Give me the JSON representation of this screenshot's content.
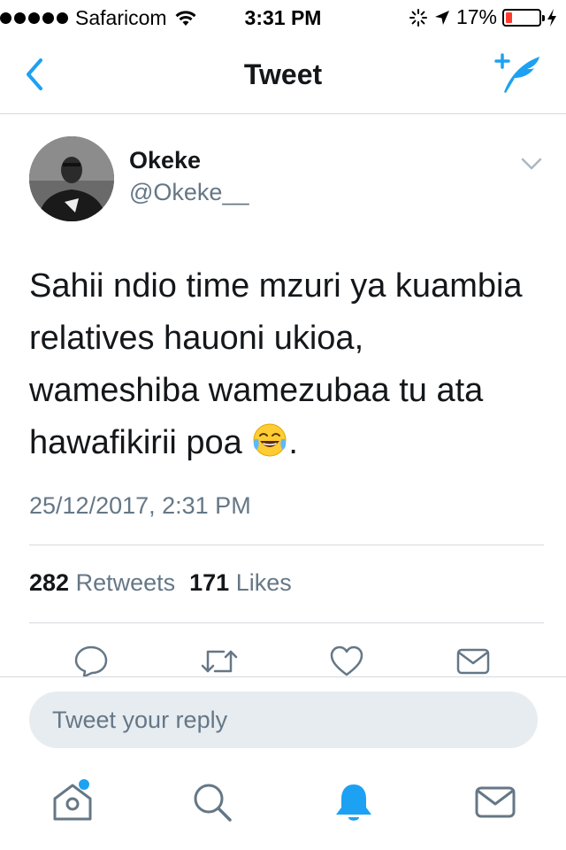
{
  "status_bar": {
    "carrier": "Safaricom",
    "time": "3:31 PM",
    "battery": "17%",
    "icons": [
      "signal-dots",
      "wifi-icon",
      "activity-spinner-icon",
      "location-arrow-icon",
      "battery-icon",
      "charging-bolt-icon"
    ],
    "battery_level": 0.17,
    "battery_color": "#ff3b30"
  },
  "nav": {
    "title": "Tweet",
    "back_icon": "chevron-left-icon",
    "compose_icon": "compose-tweet-icon",
    "accent": "#1da1f2"
  },
  "tweet": {
    "author_name": "Okeke",
    "author_handle": "@Okeke__",
    "text_lines": [
      "Sahii ndio time mzuri ya kuambia",
      "relatives hauoni ukioa,",
      "wameshiba wamezubaa tu ata",
      "hawafikirii poa"
    ],
    "text_end": ".",
    "emoji": "face-with-tears-of-joy",
    "timestamp": "25/12/2017, 2:31 PM"
  },
  "stats": {
    "retweets_count": "282",
    "retweets_label": "Retweets",
    "likes_count": "171",
    "likes_label": "Likes"
  },
  "actions": [
    "reply-icon",
    "retweet-icon",
    "like-icon",
    "direct-message-icon"
  ],
  "reply": {
    "placeholder": "Tweet your reply"
  },
  "tab_bar": {
    "items": [
      "home-icon",
      "search-icon",
      "notifications-icon",
      "messages-icon"
    ],
    "active": "notifications-icon"
  }
}
